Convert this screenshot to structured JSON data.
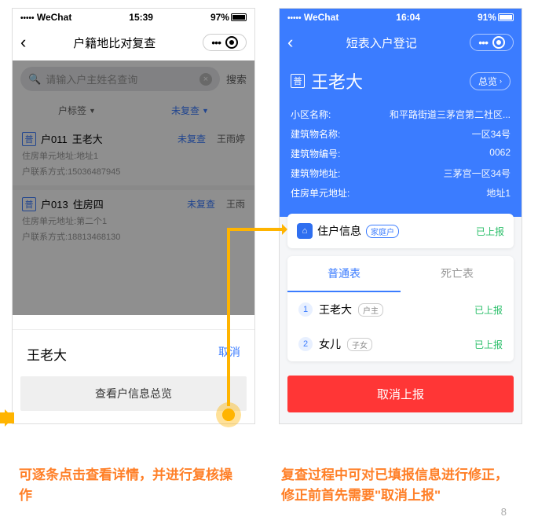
{
  "phone1": {
    "status": {
      "carrier": "WeChat",
      "time": "15:39",
      "battery": "97%"
    },
    "nav_title": "户籍地比对复查",
    "search": {
      "placeholder": "请输入户主姓名查询",
      "btn": "搜索"
    },
    "filters": {
      "tag": "户标签",
      "status": "未复查"
    },
    "items": [
      {
        "code": "户011",
        "name": "王老大",
        "status": "未复查",
        "reviewer": "王雨婷",
        "addr_label": "住房单元地址:",
        "addr": "地址1",
        "contact_label": "户联系方式:",
        "contact": "15036487945"
      },
      {
        "code": "户013",
        "name": "住房四",
        "status": "未复查",
        "reviewer": "王雨",
        "addr_label": "住房单元地址:",
        "addr": "第二个1",
        "contact_label": "户联系方式:",
        "contact": "18813468130"
      }
    ],
    "sheet": {
      "title": "王老大",
      "cancel": "取消",
      "action": "查看户信息总览"
    }
  },
  "phone2": {
    "status": {
      "carrier": "WeChat",
      "time": "16:04",
      "battery": "91%"
    },
    "nav_title": "短表入户登记",
    "badge": "普",
    "name": "王老大",
    "overview": "总览",
    "fields": [
      {
        "k": "小区名称:",
        "v": "和平路街道三茅宫第二社区..."
      },
      {
        "k": "建筑物名称:",
        "v": "一区34号"
      },
      {
        "k": "建筑物编号:",
        "v": "0062"
      },
      {
        "k": "建筑物地址:",
        "v": "三茅宫一区34号"
      },
      {
        "k": "住房单元地址:",
        "v": "地址1"
      }
    ],
    "card1": {
      "title": "住户信息",
      "tag": "家庭户",
      "status": "已上报"
    },
    "tabs": {
      "a": "普通表",
      "b": "死亡表"
    },
    "members": [
      {
        "n": "1",
        "name": "王老大",
        "role": "户主",
        "status": "已上报"
      },
      {
        "n": "2",
        "name": "女儿",
        "role": "子女",
        "status": "已上报"
      }
    ],
    "cancel_btn": "取消上报"
  },
  "captions": {
    "c1": "可逐条点击查看详情，并进行复核操作",
    "c2": "复查过程中可对已填报信息进行修正，修正前首先需要\"取消上报\""
  },
  "page_num": "8"
}
